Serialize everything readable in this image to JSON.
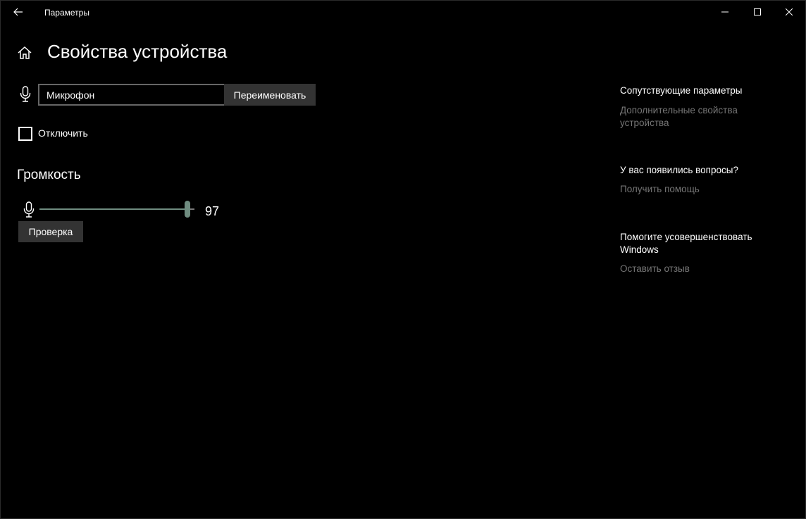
{
  "titlebar": {
    "app_title": "Параметры"
  },
  "header": {
    "page_title": "Свойства устройства"
  },
  "device": {
    "name_value": "Микрофон",
    "rename_label": "Переименовать",
    "disable_label": "Отключить",
    "disable_checked": false
  },
  "volume": {
    "heading": "Громкость",
    "value": "97",
    "level_percent": 97,
    "test_label": "Проверка"
  },
  "side": {
    "related_heading": "Сопутствующие параметры",
    "related_link": "Дополнительные свойства устройства",
    "questions_heading": "У вас появились вопросы?",
    "questions_link": "Получить помощь",
    "improve_heading": "Помогите усовершенствовать Windows",
    "improve_link": "Оставить отзыв"
  },
  "colors": {
    "background": "#000000",
    "accent": "#6f8c80",
    "button_bg": "#333333",
    "link_muted": "#767676"
  },
  "icons": [
    "back-arrow-icon",
    "minimize-icon",
    "maximize-icon",
    "close-icon",
    "home-icon",
    "microphone-icon",
    "checkbox-icon"
  ]
}
